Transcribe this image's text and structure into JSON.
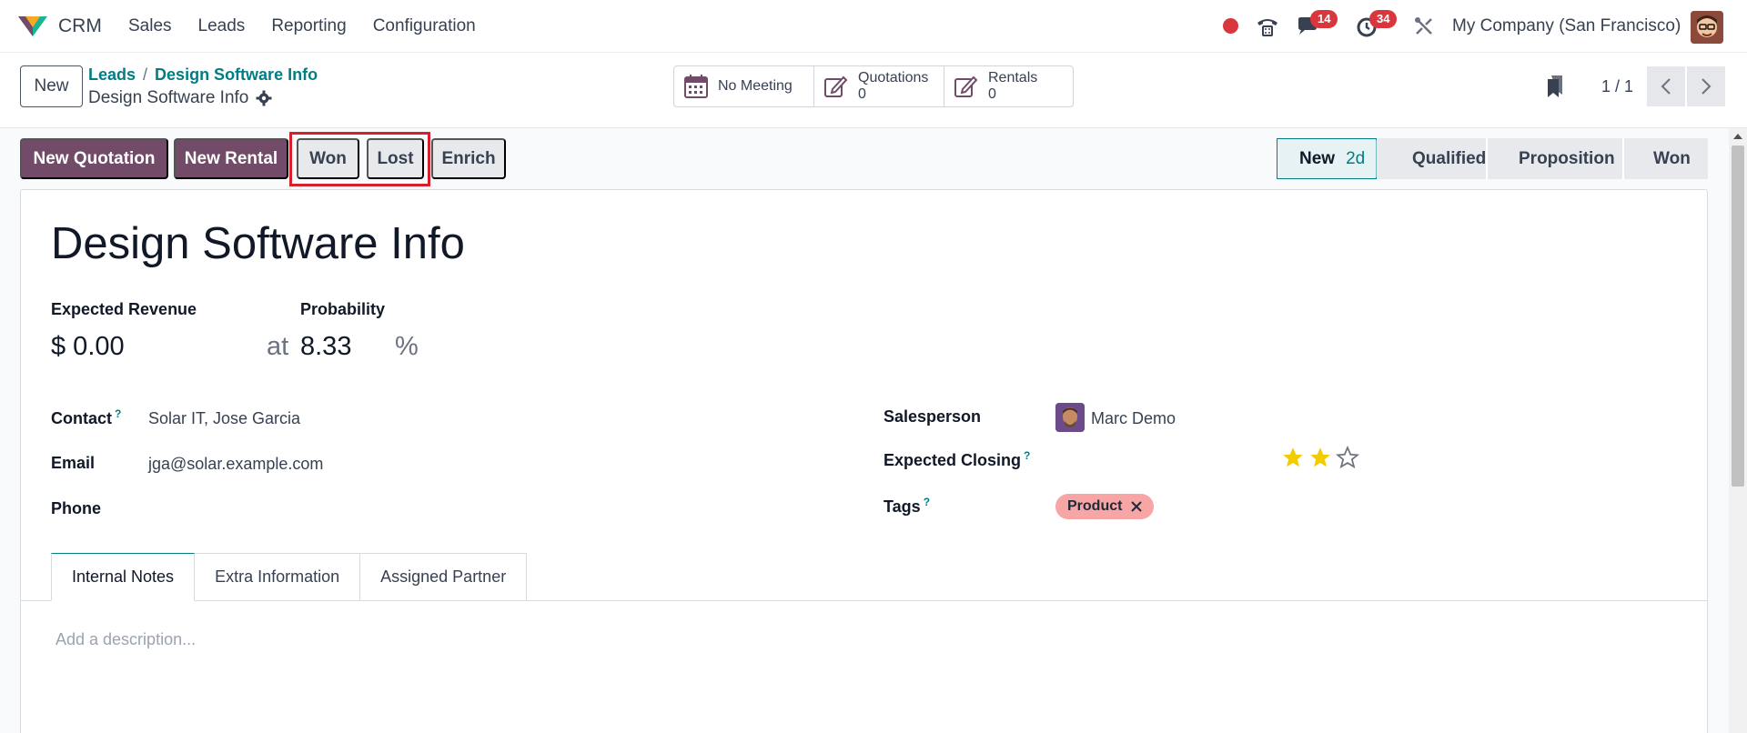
{
  "navbar": {
    "app_name": "CRM",
    "menu": [
      "Sales",
      "Leads",
      "Reporting",
      "Configuration"
    ],
    "chat_badge": "14",
    "activity_badge": "34",
    "company": "My Company (San Francisco)"
  },
  "breadcrumb": {
    "new_label": "New",
    "parent": "Leads",
    "current": "Design Software Info",
    "record": "Design Software Info"
  },
  "smart_buttons": {
    "meeting": "No Meeting",
    "quotations_label": "Quotations",
    "quotations_count": "0",
    "rentals_label": "Rentals",
    "rentals_count": "0"
  },
  "pager": {
    "value": "1 / 1"
  },
  "actions": {
    "new_quotation": "New Quotation",
    "new_rental": "New Rental",
    "won": "Won",
    "lost": "Lost",
    "enrich": "Enrich"
  },
  "stages": [
    {
      "label": "New",
      "duration": "2d"
    },
    {
      "label": "Qualified"
    },
    {
      "label": "Proposition"
    },
    {
      "label": "Won"
    }
  ],
  "form": {
    "title": "Design Software Info",
    "expected_revenue_label": "Expected Revenue",
    "expected_revenue": "$ 0.00",
    "at": "at",
    "probability_label": "Probability",
    "probability": "8.33",
    "percent": "%",
    "contact_label": "Contact",
    "contact": "Solar IT, Jose Garcia",
    "email_label": "Email",
    "email": "jga@solar.example.com",
    "phone_label": "Phone",
    "salesperson_label": "Salesperson",
    "salesperson": "Marc Demo",
    "expected_closing_label": "Expected Closing",
    "tags_label": "Tags",
    "tag": "Product",
    "priority_stars": 2,
    "help_mark": "?"
  },
  "tabs": [
    "Internal Notes",
    "Extra Information",
    "Assigned Partner"
  ],
  "description_placeholder": "Add a description...",
  "colors": {
    "primary": "#714b67",
    "accent": "#017e84",
    "danger": "#d9363e",
    "tag": "#f8a5a5",
    "star": "#f3cc00"
  }
}
